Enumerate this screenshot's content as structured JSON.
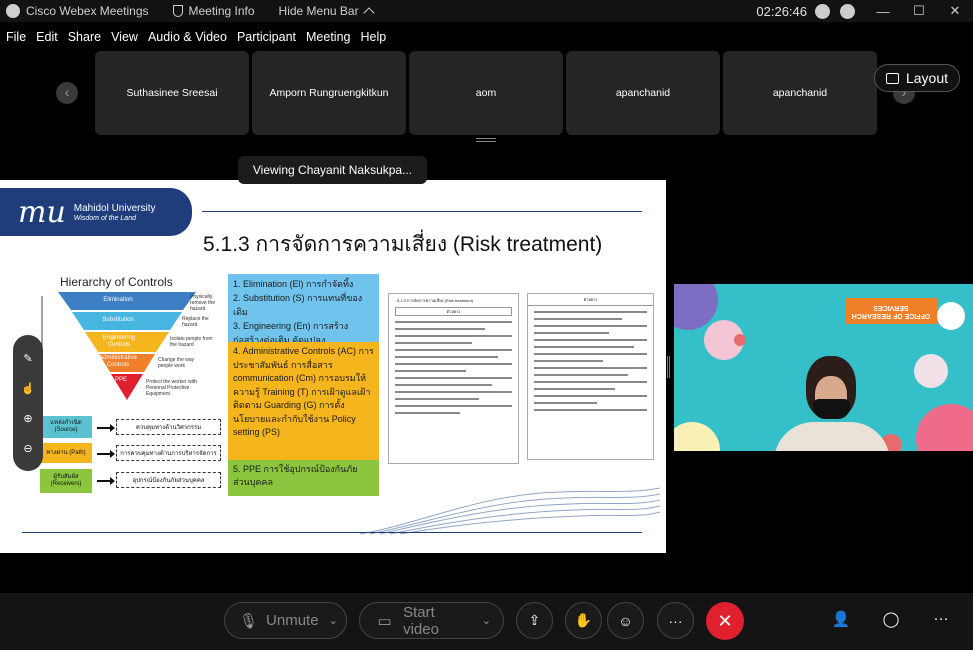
{
  "titlebar": {
    "app_name": "Cisco Webex Meetings",
    "meeting_info": "Meeting Info",
    "hide_menu_bar": "Hide Menu Bar",
    "clock": "02:26:46"
  },
  "menu": [
    "File",
    "Edit",
    "Share",
    "View",
    "Audio & Video",
    "Participant",
    "Meeting",
    "Help"
  ],
  "participants": [
    "Suthasinee Sreesai",
    "Amporn Rungruengkitkun",
    "aom",
    "apanchanid",
    "apanchanid"
  ],
  "layout_label": "Layout",
  "viewing_label": "Viewing Chayanit Naksukpa...",
  "slide": {
    "logo_mark": "mu",
    "logo_university": "Mahidol University",
    "logo_motto": "Wisdom of the Land",
    "title": "5.1.3 การจัดการความเสี่ยง (Risk treatment)",
    "hierarchy_title": "Hierarchy of Controls",
    "pyramid": [
      "Elimination",
      "Substitution",
      "Engineering Controls",
      "Administrative Controls",
      "PPE"
    ],
    "pyramid_notes": [
      "Physically remove the hazard",
      "Replace the hazard",
      "Isolate people from the hazard",
      "Change the way people work",
      "Protect the worker with Personal Protective Equipment"
    ],
    "blue_box": [
      "1. Elimination (El) การกำจัดทิ้ง",
      "2. Substitution (S) การแทนที่ของเดิม",
      "3. Engineering (En) การสร้าง ก่อสร้างต่อเติม ดัดแปลง"
    ],
    "orange_box": "4. Administrative Controls (AC) การประชาสัมพันธ์ การสื่อสาร communication (Cm) การอบรมให้ความรู้ Training (T) การเฝ้าดูแลเฝ้าติดตาม Guarding (G) การตั้งนโยบายและกำกับใช้งาน Policy setting (PS)",
    "green_box": "5. PPE การใช้อุปกรณ์ป้องกันภัยส่วนบุคคล",
    "source_rows": [
      {
        "label": "แหล่งกำเนิด (Source)",
        "desc": "ควบคุมทางด้านวิศวกรรม"
      },
      {
        "label": "ทางผ่าน (Path)",
        "desc": "การควบคุมทางด้านการบริหารจัดการ"
      },
      {
        "label": "ผู้รับสัมผัส (Receivers)",
        "desc": "อุปกรณ์ป้องกันภัยส่วนบุคคล"
      }
    ],
    "doc1_title": "5.1.3 การจัดการความเสี่ยง (Risk treatment)",
    "doc_header": "ตัวอย่าง"
  },
  "video": {
    "banner": "OFFICE OF RESEARCH SERVICES"
  },
  "controls": {
    "unmute": "Unmute",
    "start_video": "Start video"
  },
  "colors": {
    "end_button": "#e0202e",
    "slide_blue": "#70c3ec",
    "slide_orange": "#f5b51d",
    "slide_green": "#8cc63f",
    "mu_navy": "#1f3d7a"
  }
}
